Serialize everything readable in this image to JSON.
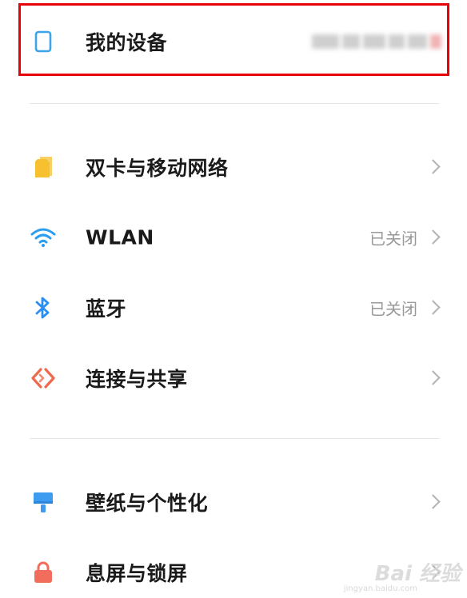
{
  "my_device": {
    "label": "我的设备",
    "icon": "phone-outline-icon"
  },
  "network_items": [
    {
      "label": "双卡与移动网络",
      "status": "",
      "icon": "sim-card-icon"
    },
    {
      "label": "WLAN",
      "status": "已关闭",
      "icon": "wifi-icon"
    },
    {
      "label": "蓝牙",
      "status": "已关闭",
      "icon": "bluetooth-icon"
    },
    {
      "label": "连接与共享",
      "status": "",
      "icon": "connection-share-icon"
    }
  ],
  "personal_items": [
    {
      "label": "壁纸与个性化",
      "status": "",
      "icon": "wallpaper-brush-icon"
    },
    {
      "label": "息屏与锁屏",
      "status": "",
      "icon": "lock-icon"
    }
  ],
  "watermark": {
    "text": "Bai 经验",
    "url": "jingyan.baidu.com"
  },
  "colors": {
    "highlight": "#e8000b",
    "sim": "#f7c02f",
    "wifi": "#2a9ef0",
    "bluetooth": "#2a8ff0",
    "connection": "#ef6a4d",
    "wallpaper": "#3d9bf0",
    "lock": "#f26d5b",
    "device": "#3aa4ec"
  }
}
